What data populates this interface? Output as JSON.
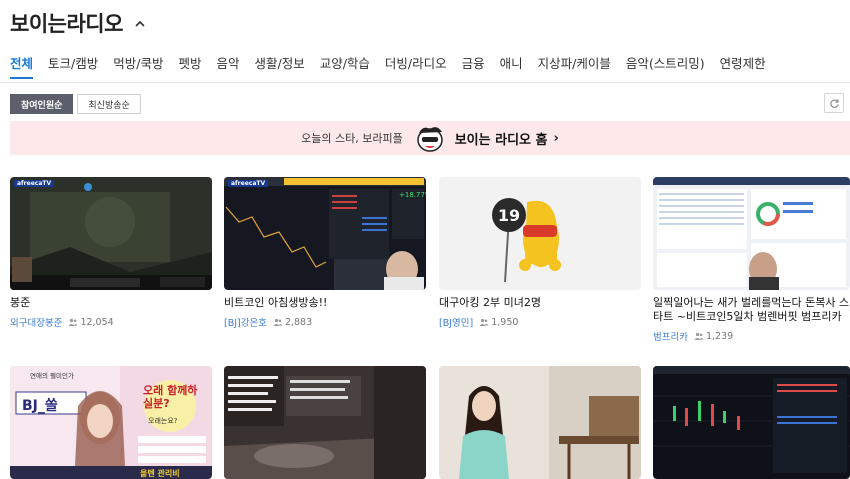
{
  "header": {
    "title": "보이는라디오"
  },
  "tabs": [
    "전체",
    "토크/캠방",
    "먹방/쿡방",
    "펫방",
    "음악",
    "생활/정보",
    "교양/학습",
    "더빙/라디오",
    "금융",
    "애니",
    "지상파/케이블",
    "음악(스트리밍)",
    "연령제한"
  ],
  "active_tab": 0,
  "sort": {
    "by_viewers": "참여인원순",
    "by_recent": "최신방송순"
  },
  "banner": {
    "subtitle": "오늘의 스타, 보라피플",
    "main": "보이는 라디오 홈",
    "arrow": "›"
  },
  "badge": "afreecaTV",
  "cards": [
    {
      "title": "봉준",
      "streamer": "외구대장봉준",
      "viewers": "12,054",
      "icon": "game-stream-thumbnail"
    },
    {
      "title": "비트코인 아침생방송!!",
      "streamer": "[BJ]강은호",
      "viewers": "2,883",
      "icon": "stock-chart-thumbnail"
    },
    {
      "title": "대구아킹 2부 미녀2명",
      "streamer": "[BJ영민]",
      "viewers": "1,950",
      "icon": "mascot-19-thumbnail"
    },
    {
      "title": "일찍일어나는 새가 벌레를먹는다 돈복사 스타트 ~비트코인5일차 범렌버핏 범프리카",
      "streamer": "범프리카",
      "viewers": "1,239",
      "icon": "trading-dashboard-thumbnail"
    },
    {
      "title": "BJ_쏠",
      "streamer": "",
      "viewers": "",
      "icon": "promo-poster-thumbnail"
    },
    {
      "title": "",
      "streamer": "",
      "viewers": "",
      "icon": "dark-room-thumbnail"
    },
    {
      "title": "",
      "streamer": "",
      "viewers": "",
      "icon": "news-anchor-thumbnail"
    },
    {
      "title": "",
      "streamer": "",
      "viewers": "",
      "icon": "chart-screen-thumbnail"
    }
  ],
  "poster_text": {
    "top": "연애의 펠미인가",
    "name": "BJ_쏠",
    "big": "오래 함께하실분?",
    "q": "오래는요?",
    "bottom": "을텐 관리비"
  },
  "colors": {
    "accent": "#1a7ad6",
    "banner_bg": "#fde9e9",
    "streamer": "#3b7ed6"
  }
}
